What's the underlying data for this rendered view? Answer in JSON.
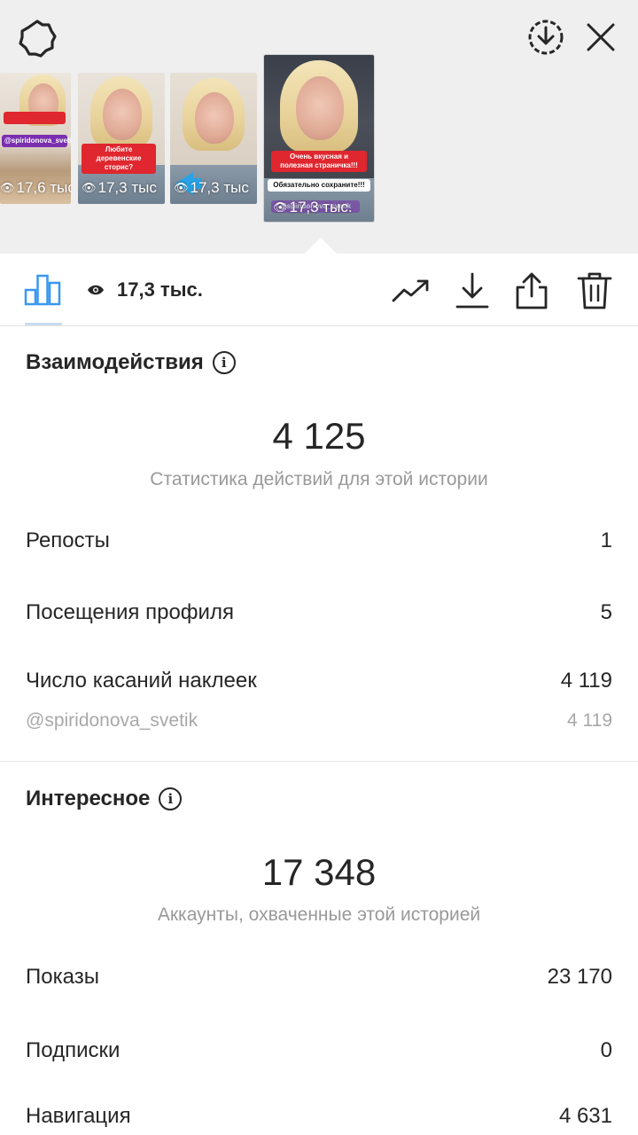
{
  "header": {
    "icons": [
      "settings-icon",
      "download-circle-icon",
      "close-icon"
    ]
  },
  "thumbnails": [
    {
      "views": "17,6 тыс",
      "sticker": "@spiridonova_svetik"
    },
    {
      "views": "17,3 тыс",
      "sticker": "Любите деревенские сторис?"
    },
    {
      "views": "17,3 тыс",
      "sticker": ""
    },
    {
      "views": "17,3 тыс.",
      "sticker": "Очень вкусная и полезная страничка!!!",
      "sticker2": "Обязательно сохраните!!!",
      "sticker3": "@spiridonova_svetik"
    }
  ],
  "toolbar": {
    "views": "17,3 тыс.",
    "icons": [
      "bar-chart-icon",
      "eye-icon",
      "trending-icon",
      "download-icon",
      "share-icon",
      "trash-icon"
    ]
  },
  "interactions": {
    "title": "Взаимодействия",
    "total": "4 125",
    "caption": "Статистика действий для этой истории",
    "rows": [
      {
        "label": "Репосты",
        "value": "1"
      },
      {
        "label": "Посещения профиля",
        "value": "5"
      },
      {
        "label": "Число касаний наклеек",
        "value": "4 119"
      }
    ],
    "sub_row": {
      "label": "@spiridonova_svetik",
      "value": "4 119"
    }
  },
  "discovery": {
    "title": "Интересное",
    "total": "17 348",
    "caption": "Аккаунты, охваченные этой историей",
    "rows": [
      {
        "label": "Показы",
        "value": "23 170"
      },
      {
        "label": "Подписки",
        "value": "0"
      },
      {
        "label": "Навигация",
        "value": "4 631"
      }
    ]
  },
  "colors": {
    "accent": "#3897f0",
    "text": "#262626",
    "muted": "#999999",
    "top_bg": "#efefef"
  }
}
